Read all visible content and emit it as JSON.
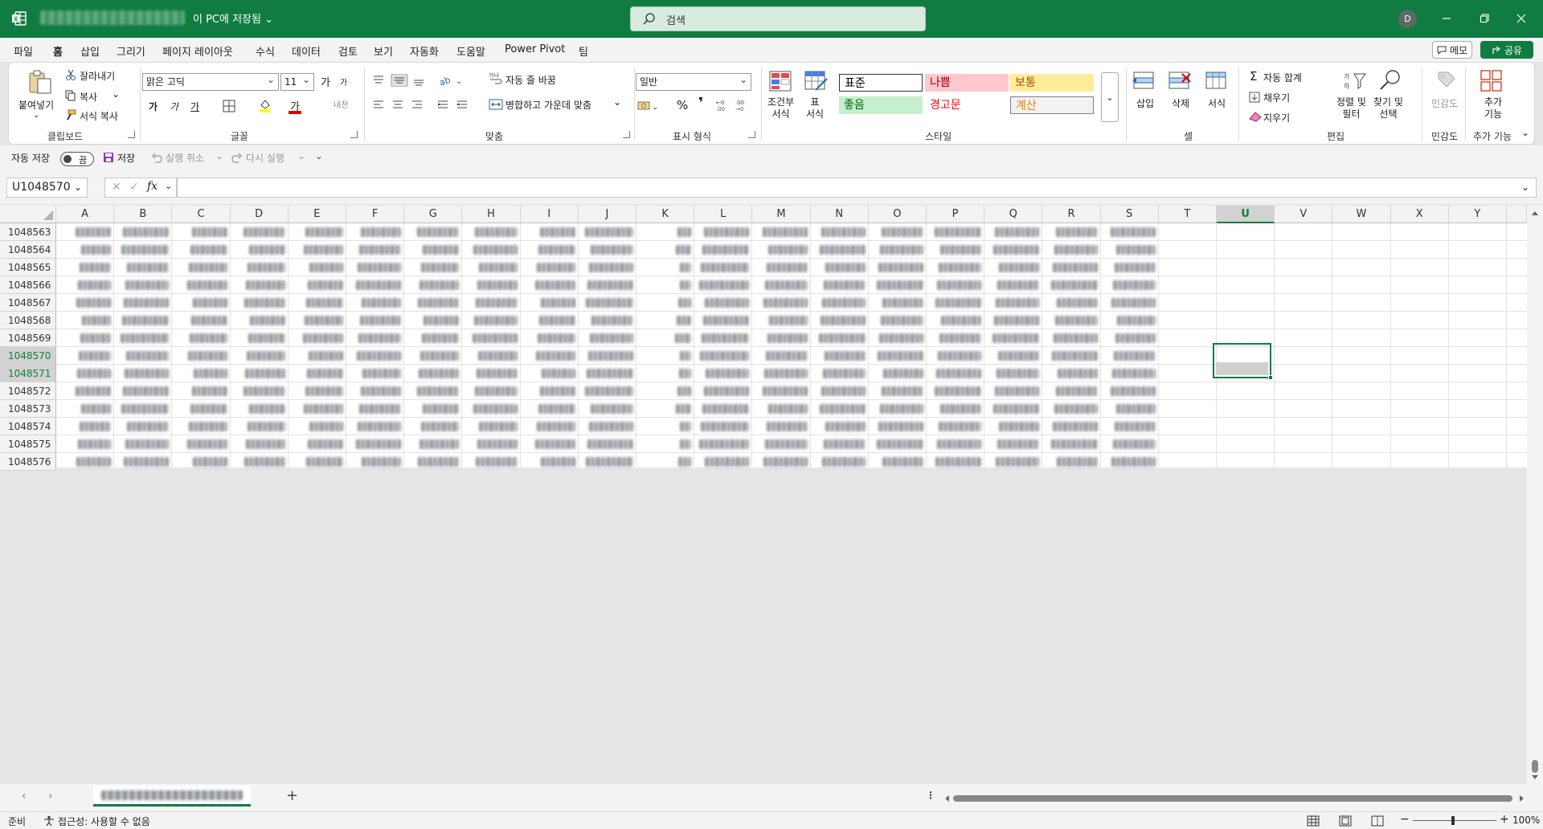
{
  "titlebar": {
    "save_status": "이 PC에 저장됨 ⌄",
    "search_placeholder": "검색",
    "user_initial": "D"
  },
  "menu": {
    "tabs": [
      "파일",
      "홈",
      "삽입",
      "그리기",
      "페이지 레이아웃",
      "수식",
      "데이터",
      "검토",
      "보기",
      "자동화",
      "도움말",
      "Power Pivot",
      "팀"
    ],
    "active_tab": "홈",
    "memo_label": "메모",
    "share_label": "공유"
  },
  "ribbon": {
    "clipboard": {
      "paste": "붙여넣기",
      "cut": "잘라내기",
      "copy": "복사",
      "format_painter": "서식 복사",
      "label": "클립보드"
    },
    "font": {
      "name": "맑은 고딕",
      "size": "11",
      "grow": "가",
      "shrink": "가",
      "bold": "가",
      "italic": "가",
      "underline": "가",
      "label": "글꼴"
    },
    "alignment": {
      "wrap": "자동 줄 바꿈",
      "merge": "병합하고 가운데 맞춤",
      "label": "맞춤"
    },
    "number": {
      "format": "일반",
      "percent": "%",
      "comma": "❜",
      "label": "표시 형식"
    },
    "styles": {
      "conditional": "조건부\n서식",
      "table": "표\n서식",
      "cells": [
        {
          "text": "표준",
          "bg": "#ffffff",
          "color": "#000000"
        },
        {
          "text": "나쁨",
          "bg": "#ffc7ce",
          "color": "#9c0006"
        },
        {
          "text": "보통",
          "bg": "#ffeb9c",
          "color": "#9c5700"
        },
        {
          "text": "좋음",
          "bg": "#c6efce",
          "color": "#006100"
        },
        {
          "text": "경고문",
          "bg": "#ffffff",
          "color": "#ff0000"
        },
        {
          "text": "계산",
          "bg": "#f2f2f2",
          "color": "#fa7d00"
        }
      ],
      "label": "스타일"
    },
    "cells": {
      "insert": "삽입",
      "delete": "삭제",
      "format": "서식",
      "label": "셀"
    },
    "editing": {
      "autosum": "자동 합계",
      "fill": "채우기",
      "clear": "지우기",
      "sort": "정렬 및\n필터",
      "find": "찾기 및\n선택",
      "label": "편집"
    },
    "sensitivity": {
      "btn": "민감도",
      "label": "민감도"
    },
    "addins": {
      "btn": "추가\n기능",
      "label": "추가 기능"
    }
  },
  "qat": {
    "autosave": "자동 저장",
    "toggle": "끔",
    "save": "저장",
    "undo": "실행 취소",
    "redo": "다시 실행"
  },
  "formula_bar": {
    "name_box": "U1048570",
    "fx": "fx",
    "value": ""
  },
  "grid": {
    "columns": [
      "A",
      "B",
      "C",
      "D",
      "E",
      "F",
      "G",
      "H",
      "I",
      "J",
      "K",
      "L",
      "M",
      "N",
      "O",
      "P",
      "Q",
      "R",
      "S",
      "T",
      "U",
      "V",
      "W",
      "X",
      "Y"
    ],
    "selected_column": "U",
    "rows": [
      "1048563",
      "1048564",
      "1048565",
      "1048566",
      "1048567",
      "1048568",
      "1048569",
      "1048570",
      "1048571",
      "1048572",
      "1048573",
      "1048574",
      "1048575",
      "1048576"
    ],
    "selected_rows": [
      "1048570",
      "1048571"
    ]
  },
  "sheetbar": {
    "add": "+"
  },
  "statusbar": {
    "ready": "준비",
    "accessibility": "접근성: 사용할 수 없음",
    "zoom": "100%"
  },
  "colors": {
    "accent": "#107c41"
  }
}
